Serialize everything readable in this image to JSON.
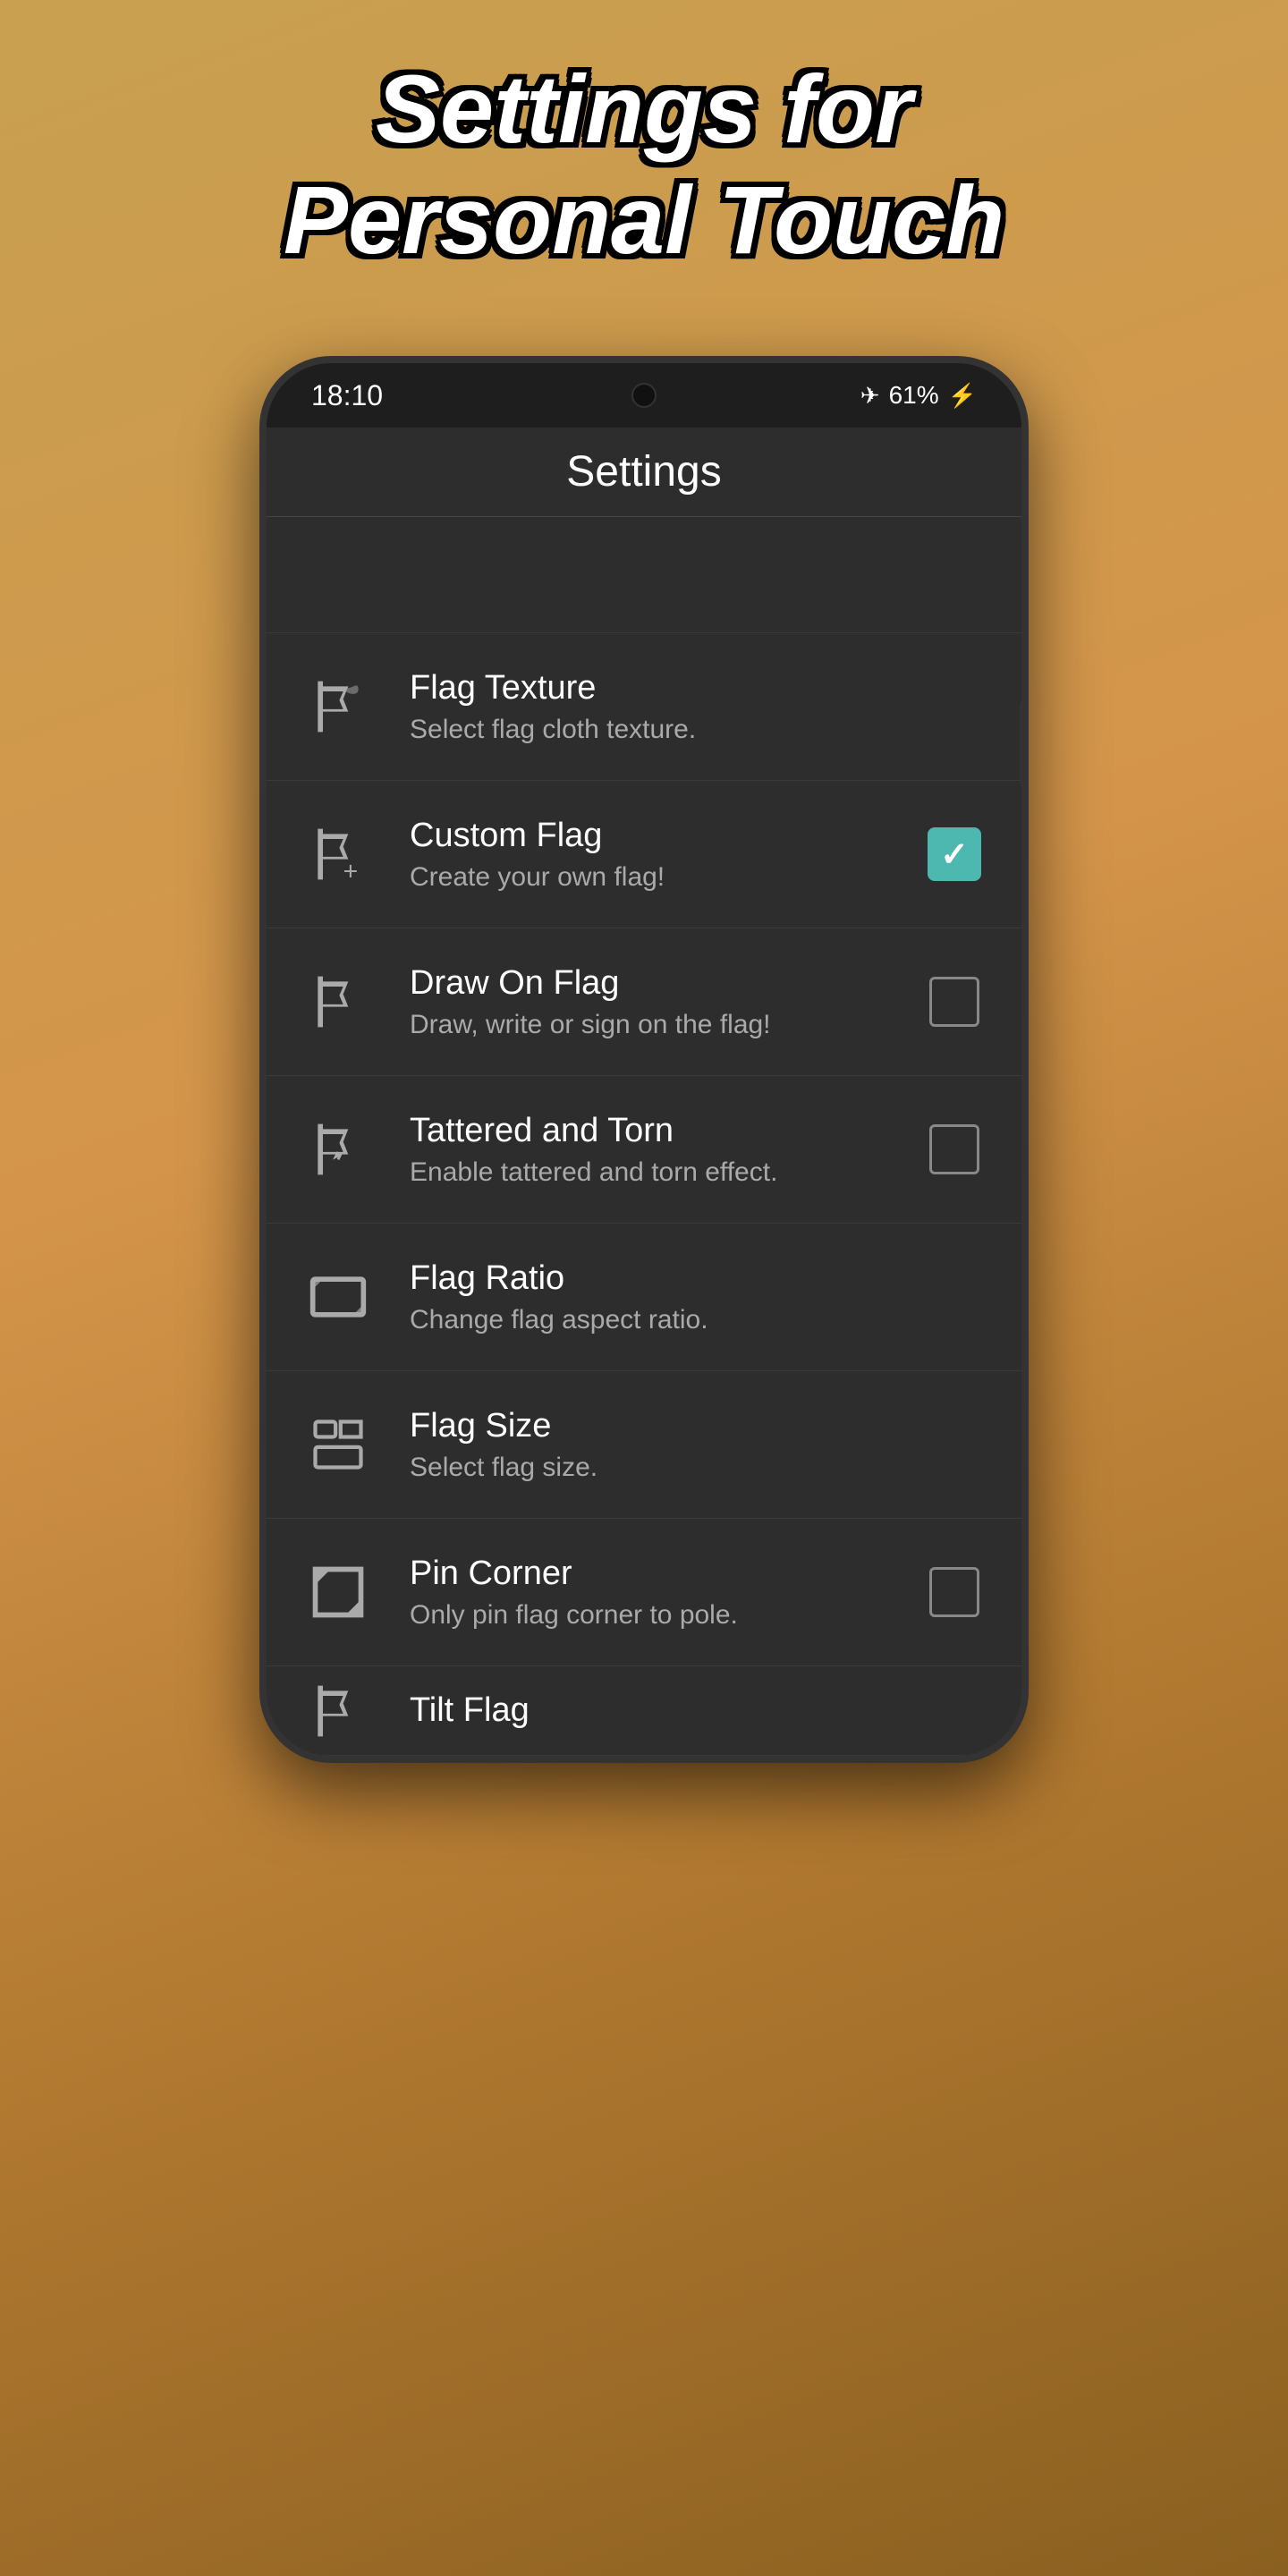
{
  "page": {
    "title_line1": "Settings for",
    "title_line2": "Personal Touch"
  },
  "status_bar": {
    "time": "18:10",
    "battery": "61%",
    "airplane_mode": true
  },
  "app_bar": {
    "title": "Settings"
  },
  "settings_items": [
    {
      "id": "flag-texture",
      "title": "Flag Texture",
      "subtitle": "Select flag cloth texture.",
      "has_checkbox": false,
      "checked": null,
      "icon": "flag-texture-icon"
    },
    {
      "id": "custom-flag",
      "title": "Custom Flag",
      "subtitle": "Create your own flag!",
      "has_checkbox": true,
      "checked": true,
      "icon": "custom-flag-icon"
    },
    {
      "id": "draw-on-flag",
      "title": "Draw On Flag",
      "subtitle": "Draw, write or sign on the flag!",
      "has_checkbox": true,
      "checked": false,
      "icon": "draw-flag-icon"
    },
    {
      "id": "tattered-torn",
      "title": "Tattered and Torn",
      "subtitle": "Enable tattered and torn effect.",
      "has_checkbox": true,
      "checked": false,
      "icon": "tattered-icon"
    },
    {
      "id": "flag-ratio",
      "title": "Flag Ratio",
      "subtitle": "Change flag aspect ratio.",
      "has_checkbox": false,
      "checked": null,
      "icon": "ratio-icon"
    },
    {
      "id": "flag-size",
      "title": "Flag Size",
      "subtitle": "Select flag size.",
      "has_checkbox": false,
      "checked": null,
      "icon": "size-icon"
    },
    {
      "id": "pin-corner",
      "title": "Pin Corner",
      "subtitle": "Only pin flag corner to pole.",
      "has_checkbox": true,
      "checked": false,
      "icon": "pin-corner-icon"
    },
    {
      "id": "tilt-flag",
      "title": "Tilt Flag",
      "subtitle": "",
      "has_checkbox": false,
      "checked": null,
      "icon": "tilt-icon"
    }
  ],
  "colors": {
    "checkbox_checked": "#4db8b0",
    "background": "#2d2d2d",
    "text_primary": "#ffffff",
    "text_secondary": "#aaaaaa"
  }
}
